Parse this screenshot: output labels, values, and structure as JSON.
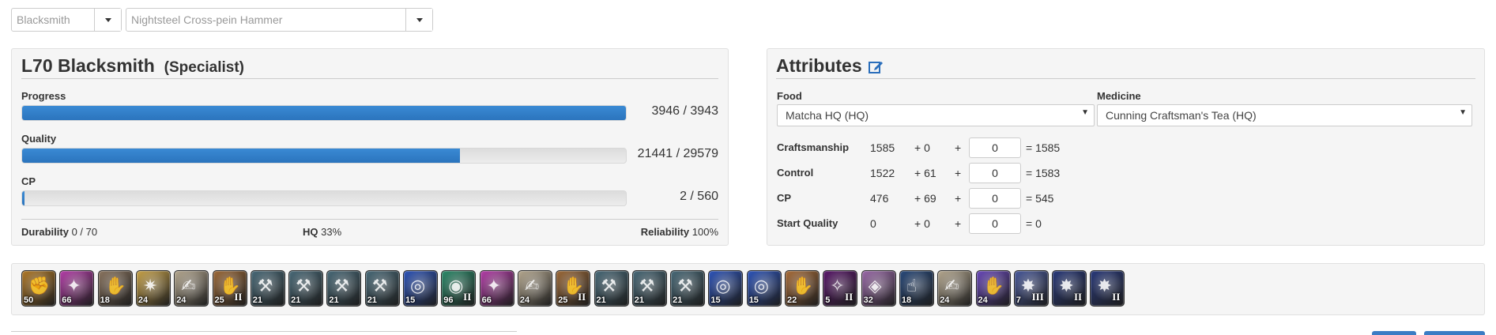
{
  "selectors": {
    "class": "Blacksmith",
    "recipe": "Nightsteel Cross-pein Hammer"
  },
  "status": {
    "title": "L70 Blacksmith",
    "subtitle": "(Specialist)",
    "progress": {
      "label": "Progress",
      "text": "3946 / 3943",
      "fraction": 1.0
    },
    "quality": {
      "label": "Quality",
      "text": "21441 / 29579",
      "fraction": 0.7249
    },
    "cp": {
      "label": "CP",
      "text": "2 / 560",
      "fraction": 0.0036
    },
    "durability_label": "Durability",
    "durability_value": "0 / 70",
    "hq_label": "HQ",
    "hq_value": "33%",
    "reliability_label": "Reliability",
    "reliability_value": "100%"
  },
  "attributes": {
    "title": "Attributes",
    "food_label": "Food",
    "food_value": "Matcha HQ (HQ)",
    "medicine_label": "Medicine",
    "medicine_value": "Cunning Craftsman's Tea (HQ)",
    "rows": [
      {
        "name": "Craftsmanship",
        "base": "1585",
        "bonus": "+ 0",
        "plus": "+",
        "input": "0",
        "total": "= 1585"
      },
      {
        "name": "Control",
        "base": "1522",
        "bonus": "+ 61",
        "plus": "+",
        "input": "0",
        "total": "= 1583"
      },
      {
        "name": "CP",
        "base": "476",
        "bonus": "+ 69",
        "plus": "+",
        "input": "0",
        "total": "= 545"
      },
      {
        "name": "Start Quality",
        "base": "0",
        "bonus": "+ 0",
        "plus": "+",
        "input": "0",
        "total": "= 0"
      }
    ]
  },
  "actions": [
    {
      "icon": "muscle-memory-icon",
      "num": "50",
      "rom": "",
      "color": "#b07a2a"
    },
    {
      "icon": "inner-quiet-icon",
      "num": "66",
      "rom": "",
      "color": "#b43fa8"
    },
    {
      "icon": "waste-not-icon",
      "num": "18",
      "rom": "",
      "color": "#8a7560"
    },
    {
      "icon": "innovation-icon",
      "num": "24",
      "rom": "",
      "color": "#c7a24a"
    },
    {
      "icon": "manipulation-icon",
      "num": "24",
      "rom": "",
      "color": "#b5a890"
    },
    {
      "icon": "great-strides-icon",
      "num": "25",
      "rom": "II",
      "color": "#9c6a3a"
    },
    {
      "icon": "hammer-touch-icon",
      "num": "21",
      "rom": "",
      "color": "#4a6a78"
    },
    {
      "icon": "hammer-touch-icon",
      "num": "21",
      "rom": "",
      "color": "#4a6a78"
    },
    {
      "icon": "hammer-touch-icon",
      "num": "21",
      "rom": "",
      "color": "#4a6a78"
    },
    {
      "icon": "hammer-touch-icon",
      "num": "21",
      "rom": "",
      "color": "#4a6a78"
    },
    {
      "icon": "steady-hand-icon",
      "num": "15",
      "rom": "",
      "color": "#2f55b8"
    },
    {
      "icon": "comfort-zone-icon",
      "num": "96",
      "rom": "II",
      "color": "#2d8a6a"
    },
    {
      "icon": "inner-quiet-icon",
      "num": "66",
      "rom": "",
      "color": "#b43fa8"
    },
    {
      "icon": "manipulation-icon",
      "num": "24",
      "rom": "",
      "color": "#b5a890"
    },
    {
      "icon": "great-strides-icon",
      "num": "25",
      "rom": "II",
      "color": "#9c6a3a"
    },
    {
      "icon": "hammer-touch-icon",
      "num": "21",
      "rom": "",
      "color": "#4a6a78"
    },
    {
      "icon": "hammer-touch-icon",
      "num": "21",
      "rom": "",
      "color": "#4a6a78"
    },
    {
      "icon": "hammer-touch-icon",
      "num": "21",
      "rom": "",
      "color": "#4a6a78"
    },
    {
      "icon": "steady-hand-icon",
      "num": "15",
      "rom": "",
      "color": "#2f55b8"
    },
    {
      "icon": "steady-hand-icon",
      "num": "15",
      "rom": "",
      "color": "#2f55b8"
    },
    {
      "icon": "hand-icon",
      "num": "22",
      "rom": "",
      "color": "#a86e3c"
    },
    {
      "icon": "byregots-blessing-icon",
      "num": "5",
      "rom": "II",
      "color": "#5a1a6a"
    },
    {
      "icon": "observe-icon",
      "num": "32",
      "rom": "",
      "color": "#9a6aa8"
    },
    {
      "icon": "trained-hand-icon",
      "num": "18",
      "rom": "",
      "color": "#2a4a7a"
    },
    {
      "icon": "manipulation-icon",
      "num": "24",
      "rom": "",
      "color": "#b5a890"
    },
    {
      "icon": "glowing-hand-icon",
      "num": "24",
      "rom": "",
      "color": "#6a4ab8"
    },
    {
      "icon": "flash-icon",
      "num": "7",
      "rom": "III",
      "color": "#4a5a9a"
    },
    {
      "icon": "flash-icon",
      "num": "",
      "rom": "II",
      "color": "#2a3a7a"
    },
    {
      "icon": "flash-icon",
      "num": "",
      "rom": "II",
      "color": "#2a3a7a"
    }
  ]
}
